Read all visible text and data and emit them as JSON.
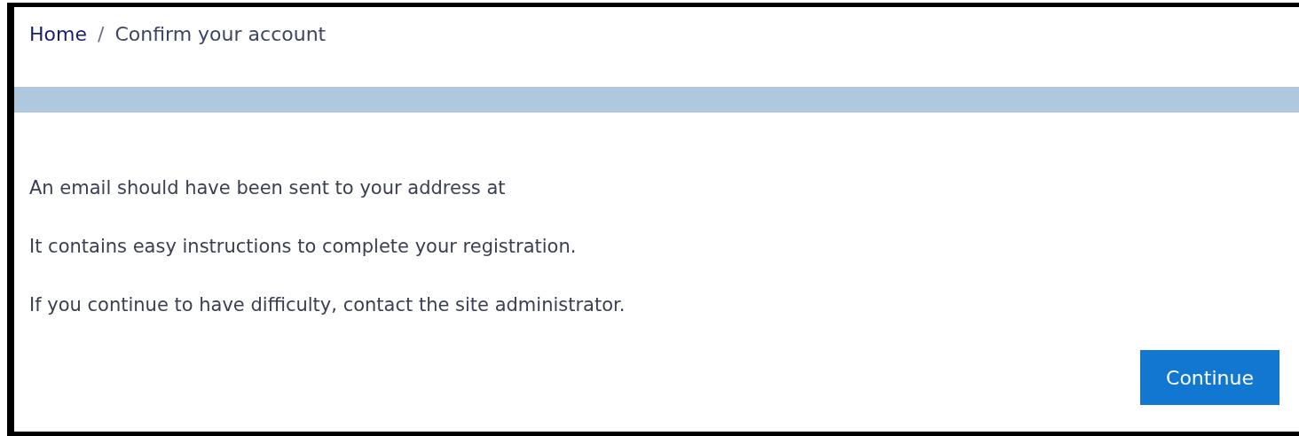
{
  "breadcrumb": [
    {
      "label": "Home",
      "kind": "link"
    },
    {
      "label": "Confirm your account",
      "kind": "current"
    }
  ],
  "breadcrumb_separator": "/",
  "paragraphs": [
    "An email should have been sent to your address at",
    "It contains easy instructions to complete your registration.",
    "If you continue to have difficulty, contact the site administrator."
  ],
  "button": {
    "label": "Continue"
  }
}
